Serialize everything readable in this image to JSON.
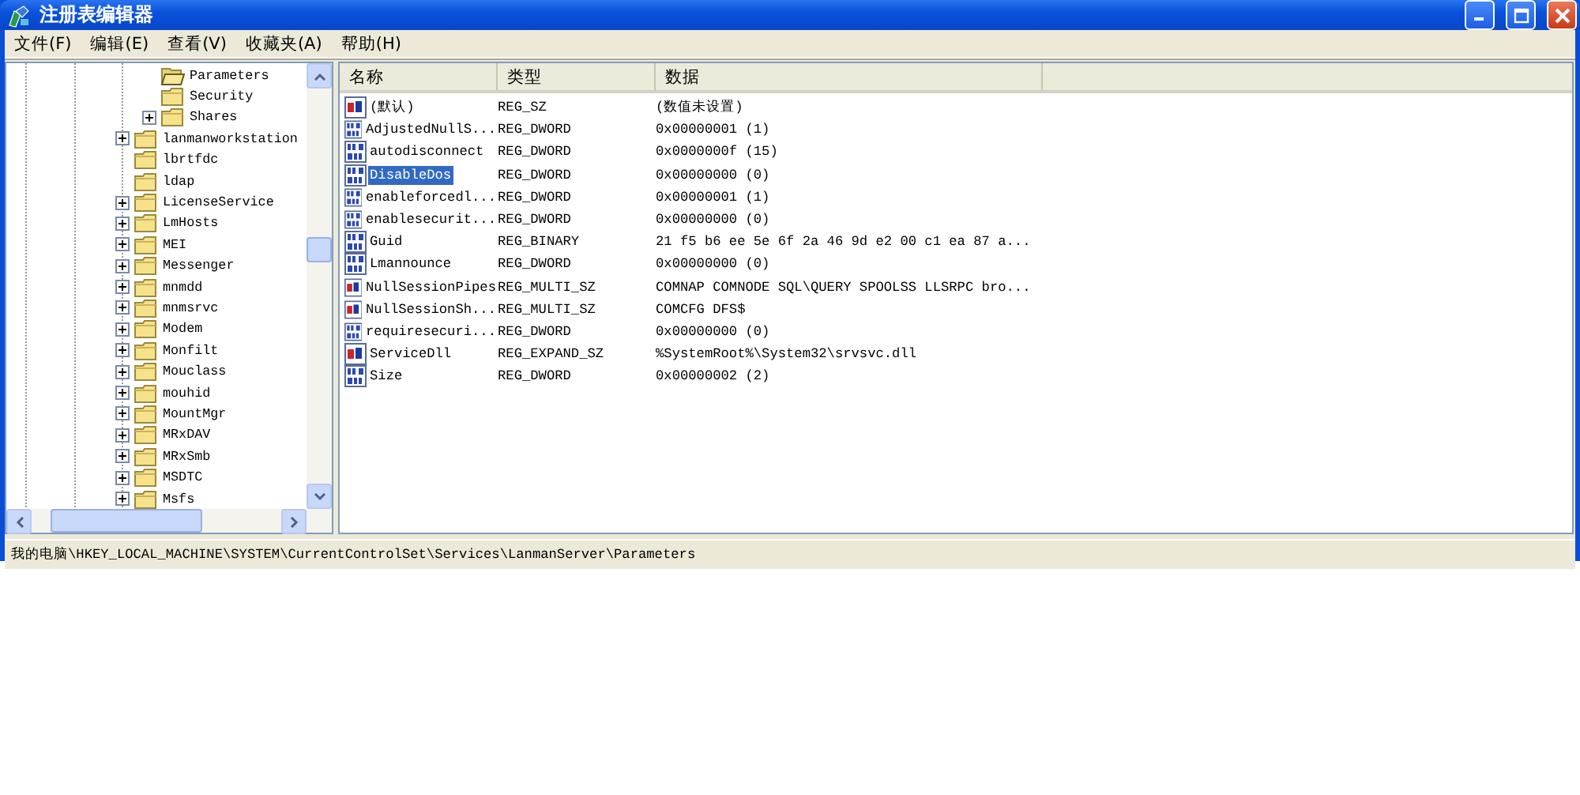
{
  "window": {
    "title": "注册表编辑器"
  },
  "menu": [
    "文件(F)",
    "编辑(E)",
    "查看(V)",
    "收藏夹(A)",
    "帮助(H)"
  ],
  "tree": {
    "continued_children": [
      {
        "label": "Parameters",
        "expandable": false,
        "open": true
      },
      {
        "label": "Security",
        "expandable": false,
        "open": false
      },
      {
        "label": "Shares",
        "expandable": true,
        "open": false
      }
    ],
    "items": [
      {
        "label": "lanmanworkstation",
        "expandable": true
      },
      {
        "label": "lbrtfdc",
        "expandable": false
      },
      {
        "label": "ldap",
        "expandable": false
      },
      {
        "label": "LicenseService",
        "expandable": true
      },
      {
        "label": "LmHosts",
        "expandable": true
      },
      {
        "label": "MEI",
        "expandable": true
      },
      {
        "label": "Messenger",
        "expandable": true
      },
      {
        "label": "mnmdd",
        "expandable": true
      },
      {
        "label": "mnmsrvc",
        "expandable": true
      },
      {
        "label": "Modem",
        "expandable": true
      },
      {
        "label": "Monfilt",
        "expandable": true
      },
      {
        "label": "Mouclass",
        "expandable": true
      },
      {
        "label": "mouhid",
        "expandable": true
      },
      {
        "label": "MountMgr",
        "expandable": true
      },
      {
        "label": "MRxDAV",
        "expandable": true
      },
      {
        "label": "MRxSmb",
        "expandable": true
      },
      {
        "label": "MSDTC",
        "expandable": true
      },
      {
        "label": "Msfs",
        "expandable": true
      }
    ]
  },
  "values": {
    "columns": [
      "名称",
      "类型",
      "数据"
    ],
    "rows": [
      {
        "kind": "string",
        "name": "(默认)",
        "type": "REG_SZ",
        "data": "(数值未设置)",
        "selected": false
      },
      {
        "kind": "binary",
        "name": "AdjustedNullS...",
        "type": "REG_DWORD",
        "data": "0x00000001 (1)",
        "selected": false
      },
      {
        "kind": "binary",
        "name": "autodisconnect",
        "type": "REG_DWORD",
        "data": "0x0000000f (15)",
        "selected": false
      },
      {
        "kind": "binary",
        "name": "DisableDos",
        "type": "REG_DWORD",
        "data": "0x00000000 (0)",
        "selected": true
      },
      {
        "kind": "binary",
        "name": "enableforcedl...",
        "type": "REG_DWORD",
        "data": "0x00000001 (1)",
        "selected": false
      },
      {
        "kind": "binary",
        "name": "enablesecurit...",
        "type": "REG_DWORD",
        "data": "0x00000000 (0)",
        "selected": false
      },
      {
        "kind": "binary",
        "name": "Guid",
        "type": "REG_BINARY",
        "data": "21 f5 b6 ee 5e 6f 2a 46 9d e2 00 c1 ea 87 a...",
        "selected": false
      },
      {
        "kind": "binary",
        "name": "Lmannounce",
        "type": "REG_DWORD",
        "data": "0x00000000 (0)",
        "selected": false
      },
      {
        "kind": "string",
        "name": "NullSessionPipes",
        "type": "REG_MULTI_SZ",
        "data": "COMNAP COMNODE SQL\\QUERY SPOOLSS LLSRPC bro...",
        "selected": false
      },
      {
        "kind": "string",
        "name": "NullSessionSh...",
        "type": "REG_MULTI_SZ",
        "data": "COMCFG DFS$",
        "selected": false
      },
      {
        "kind": "binary",
        "name": "requiresecuri...",
        "type": "REG_DWORD",
        "data": "0x00000000 (0)",
        "selected": false
      },
      {
        "kind": "string",
        "name": "ServiceDll",
        "type": "REG_EXPAND_SZ",
        "data": "%SystemRoot%\\System32\\srvsvc.dll",
        "selected": false
      },
      {
        "kind": "binary",
        "name": "Size",
        "type": "REG_DWORD",
        "data": "0x00000002 (2)",
        "selected": false
      }
    ]
  },
  "status_bar": "我的电脑\\HKEY_LOCAL_MACHINE\\SYSTEM\\CurrentControlSet\\Services\\LanmanServer\\Parameters"
}
